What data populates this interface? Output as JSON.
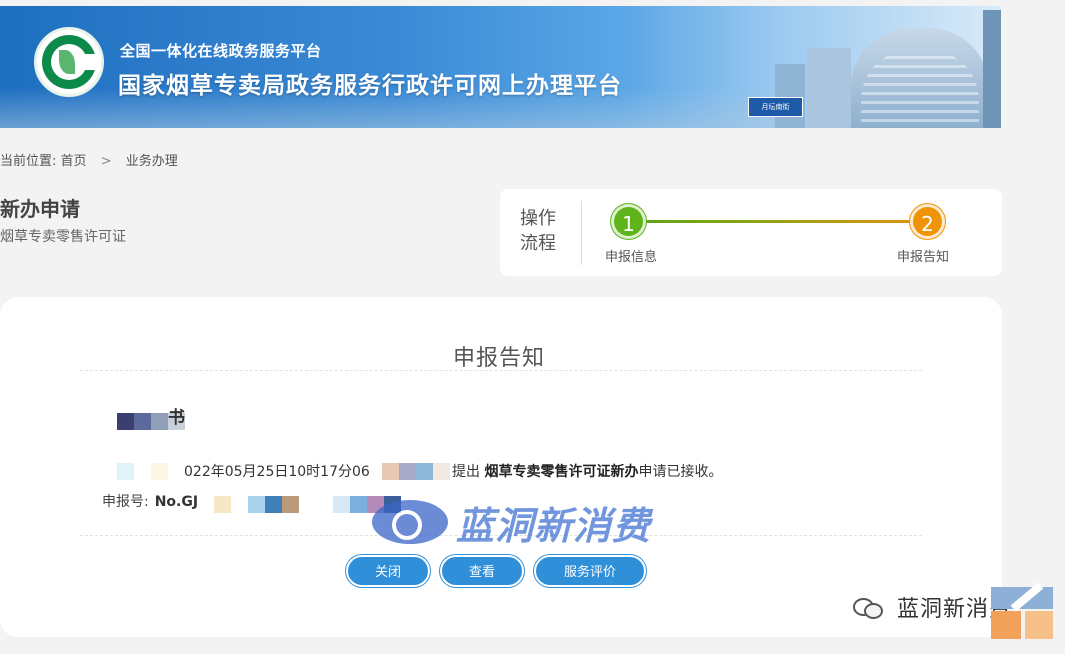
{
  "banner": {
    "subtitle": "全国一体化在线政务服务平台",
    "title": "国家烟草专卖局政务服务行政许可网上办理平台",
    "metro_sign": "月坛南街"
  },
  "breadcrumb": {
    "prefix": "当前位置:",
    "home": "首页",
    "separator": ">",
    "current": "业务办理"
  },
  "page": {
    "title": "新办申请",
    "subtitle": "烟草专卖零售许可证"
  },
  "process": {
    "label": "操作流程",
    "steps": [
      {
        "number": "1",
        "caption": "申报信息",
        "color": "#5fb31b"
      },
      {
        "number": "2",
        "caption": "申报告知",
        "color": "#ef9409"
      }
    ]
  },
  "notice": {
    "title": "申报告知",
    "letter_head": "书",
    "receipt_time": "022年05月25日10时17分06",
    "receipt_submit": "提出",
    "receipt_item": "烟草专卖零售许可证新办",
    "receipt_tail": "申请已接收。",
    "number_label": "申报号:",
    "number_value": "No.GJ"
  },
  "buttons": {
    "close": "关闭",
    "view": "查看",
    "rate": "服务评价"
  },
  "watermark": {
    "center_text": "蓝洞新消费",
    "corner_text": "蓝洞新消费"
  },
  "colors": {
    "accent_blue": "#2f8fd8",
    "step_green": "#5fb31b",
    "step_orange": "#ef9409"
  }
}
